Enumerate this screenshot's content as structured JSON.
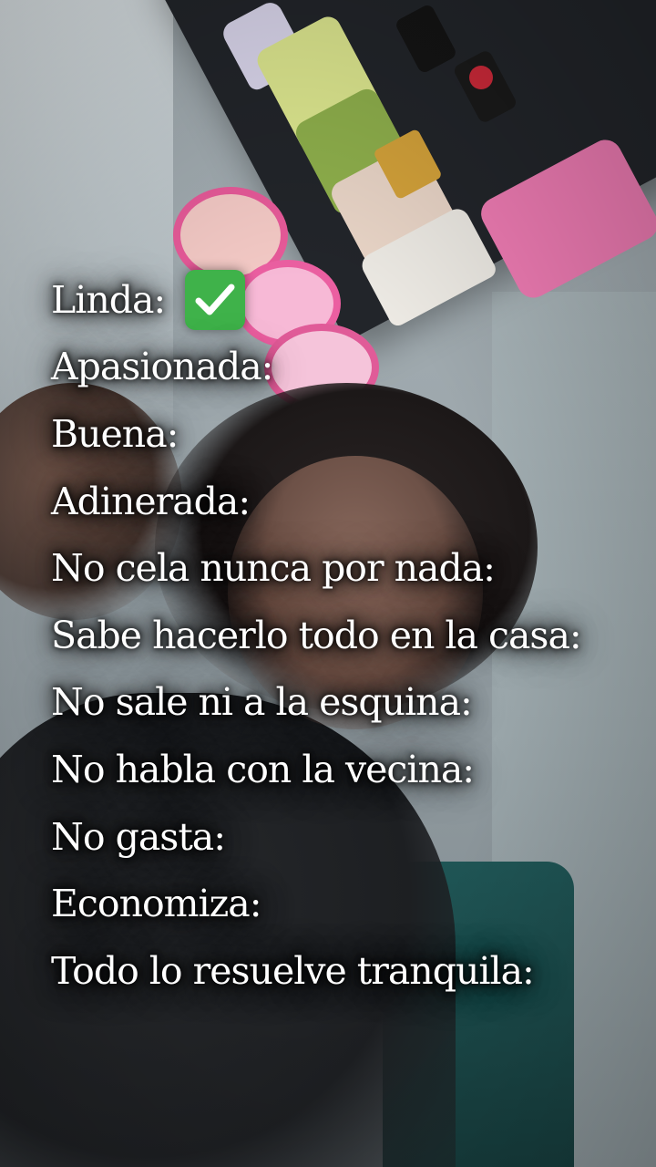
{
  "overlay": {
    "lines": [
      "Linda:",
      "Apasionada:",
      "Buena:",
      "Adinerada:",
      "No cela nunca por nada:",
      "Sabe hacerlo todo en la casa:",
      "No sale ni a la esquina:",
      "No habla con la vecina:",
      "No gasta:",
      "Economiza:",
      "Todo lo resuelve tranquila:"
    ],
    "checkmark": {
      "icon": "check-mark-button-icon",
      "color": "#3fb24a",
      "attached_to_line": 0
    }
  },
  "background": {
    "description_colors": {
      "wall": "#a6b0b5",
      "shelf": "#22252a",
      "chair": "#1f5555",
      "accent_pink": "#e75a99"
    }
  }
}
